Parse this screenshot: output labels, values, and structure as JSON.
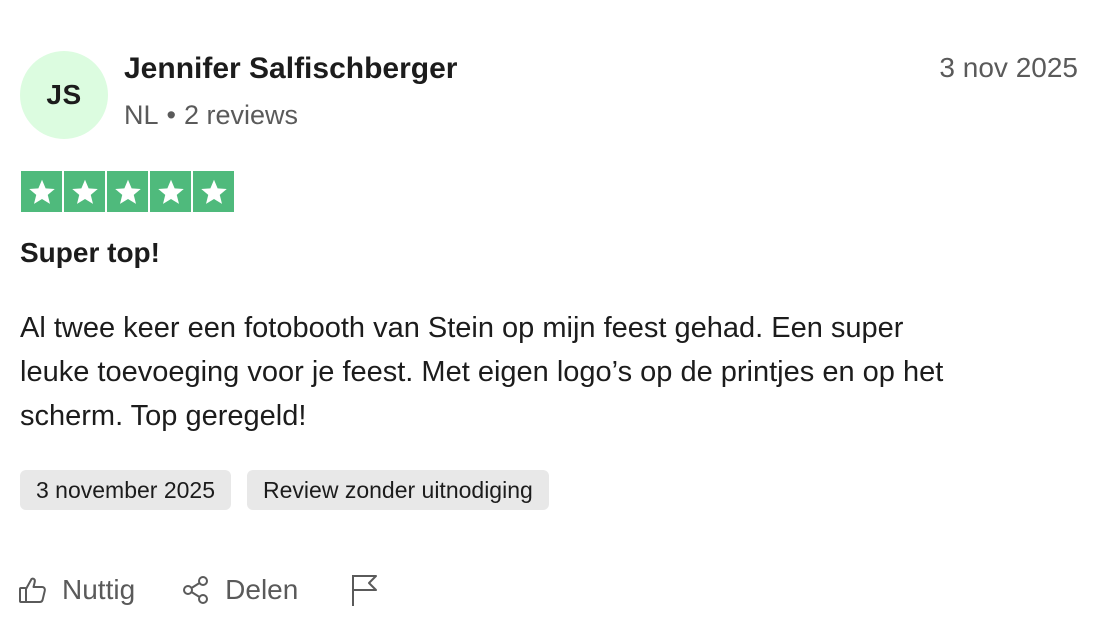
{
  "reviewer": {
    "initials": "JS",
    "name": "Jennifer Salfischberger",
    "country": "NL",
    "separator": "•",
    "review_count": "2 reviews",
    "avatar_color": "#dcfce0"
  },
  "review": {
    "date_short": "3 nov 2025",
    "rating": 5,
    "rating_max": 5,
    "star_color": "#4fba7c",
    "title": "Super top!",
    "body": "Al twee keer een fotobooth van Stein op mijn feest gehad. Een super leuke toevoeging voor je feest. Met eigen logo’s op de printjes en op het scherm. Top geregeld!",
    "tags": [
      "3 november 2025",
      "Review zonder uitnodiging"
    ]
  },
  "actions": {
    "useful_label": "Nuttig",
    "useful_icon": "thumbs-up-icon",
    "share_label": "Delen",
    "share_icon": "share-icon",
    "report_icon": "flag-icon"
  }
}
